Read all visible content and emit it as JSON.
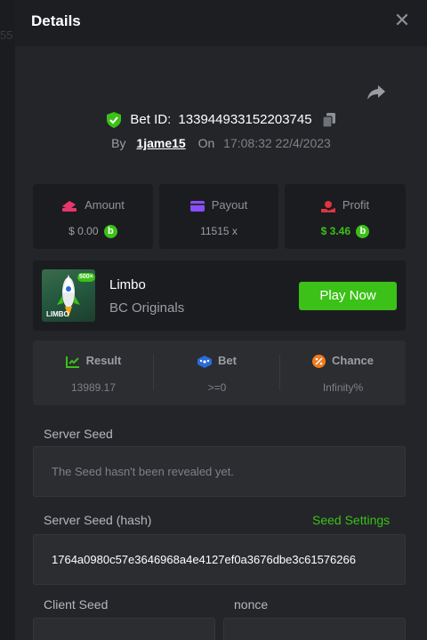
{
  "backdrop": {
    "partial_text": "55"
  },
  "modal": {
    "title": "Details",
    "close_glyph": "✕"
  },
  "bet": {
    "id_label": "Bet ID:",
    "id": "133944933152203745",
    "by_label": "By",
    "user": "1jame15",
    "on_label": "On",
    "datetime": "17:08:32 22/4/2023"
  },
  "stats": {
    "amount": {
      "label": "Amount",
      "value": "$ 0.00",
      "icon": "amount-icon"
    },
    "payout": {
      "label": "Payout",
      "value": "11515 x",
      "icon": "payout-icon"
    },
    "profit": {
      "label": "Profit",
      "value": "$ 3.46",
      "icon": "profit-icon"
    }
  },
  "game": {
    "name": "Limbo",
    "provider": "BC Originals",
    "thumb_text": "LIMBO",
    "thumb_badge": "500×",
    "play_label": "Play Now"
  },
  "result": {
    "result_label": "Result",
    "result_value": "13989.17",
    "bet_label": "Bet",
    "bet_value": ">=0",
    "chance_label": "Chance",
    "chance_value": "Infinity%"
  },
  "seeds": {
    "server_seed_label": "Server Seed",
    "server_seed_value": "The Seed hasn't been revealed yet.",
    "server_hash_label": "Server Seed (hash)",
    "seed_settings_label": "Seed Settings",
    "server_hash_value": "1764a0980c57e3646968a4e4127ef0a3676dbe3c61576266",
    "client_seed_label": "Client Seed",
    "nonce_label": "nonce"
  },
  "colors": {
    "accent_green": "#3bc117",
    "modal_bg": "#232529",
    "card_bg": "#1b1c20"
  }
}
